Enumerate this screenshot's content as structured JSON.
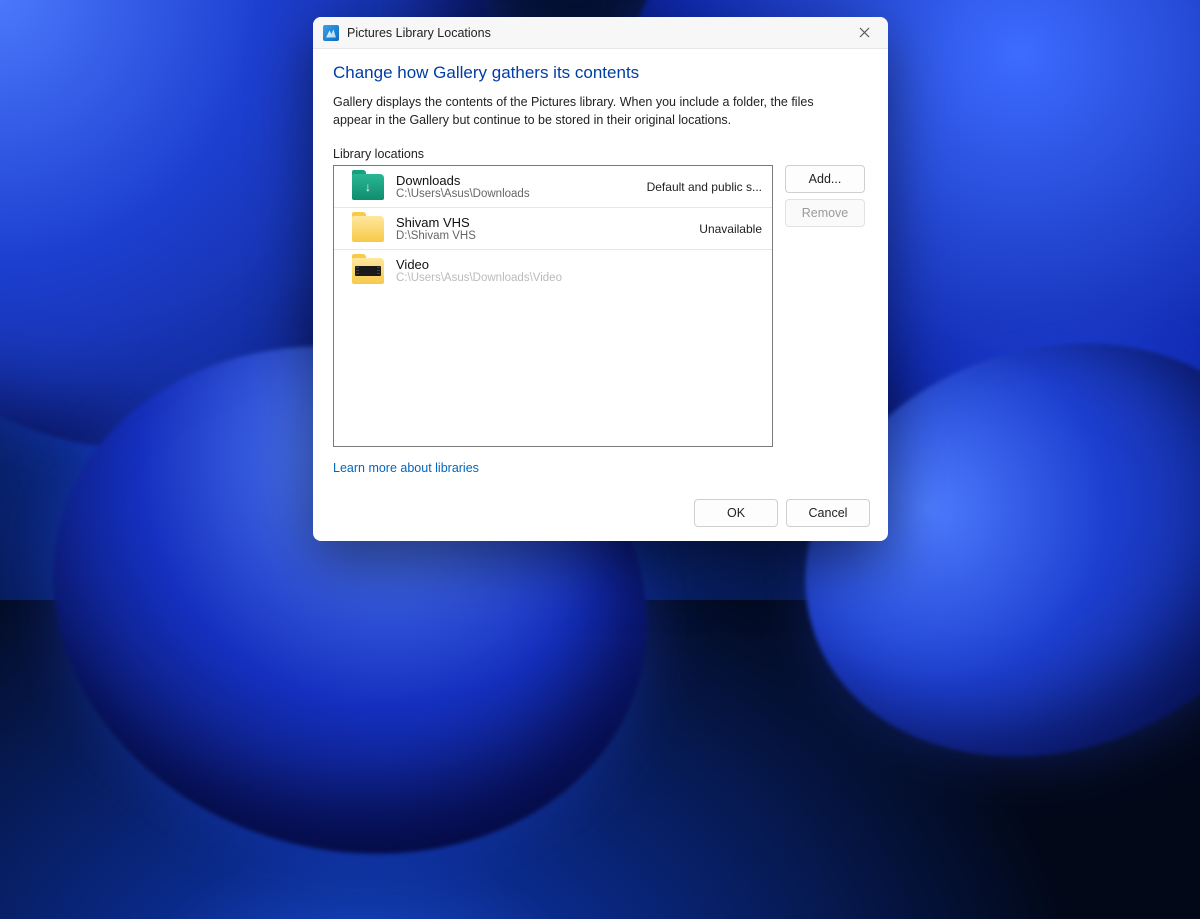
{
  "window": {
    "title": "Pictures Library Locations"
  },
  "headline": "Change how Gallery gathers its contents",
  "description": "Gallery displays the contents of the Pictures library. When you include a folder, the files appear in the Gallery but continue to be stored in their original locations.",
  "list_label": "Library locations",
  "locations": [
    {
      "name": "Downloads",
      "path": "C:\\Users\\Asus\\Downloads",
      "status": "Default and public s...",
      "icon": "teal-download"
    },
    {
      "name": "Shivam VHS",
      "path": "D:\\Shivam VHS",
      "status": "Unavailable",
      "icon": "yellow"
    },
    {
      "name": "Video",
      "path": "C:\\Users\\Asus\\Downloads\\Video",
      "status": "",
      "icon": "video"
    }
  ],
  "buttons": {
    "add": "Add...",
    "remove": "Remove",
    "ok": "OK",
    "cancel": "Cancel"
  },
  "learn_more": "Learn more about libraries"
}
